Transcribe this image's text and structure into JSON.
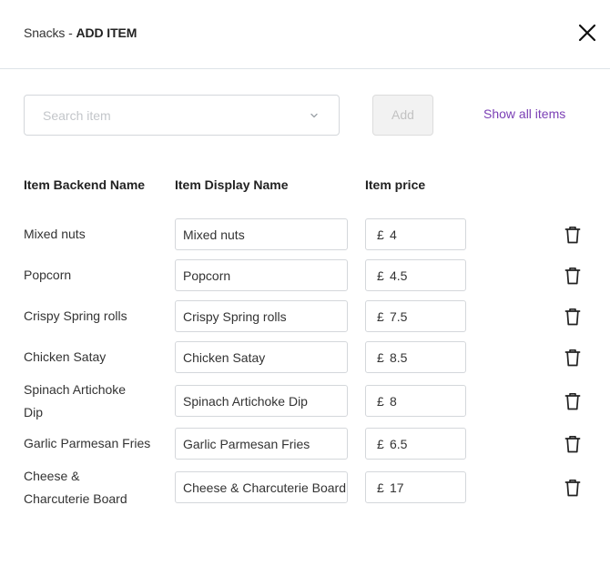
{
  "header": {
    "category": "Snacks",
    "separator": " - ",
    "action": "ADD ITEM"
  },
  "search": {
    "placeholder": "Search item",
    "value": ""
  },
  "add_label": "Add",
  "show_all_label": "Show all items",
  "columns": [
    "Item Backend Name",
    "Item Display Name",
    "Item price"
  ],
  "currency_symbol": "£",
  "items": [
    {
      "backend_lines": [
        "Mixed nuts"
      ],
      "display": "Mixed nuts",
      "price": "4"
    },
    {
      "backend_lines": [
        "Popcorn"
      ],
      "display": "Popcorn",
      "price": "4.5"
    },
    {
      "backend_lines": [
        "Crispy Spring rolls"
      ],
      "display": "Crispy Spring rolls",
      "price": "7.5"
    },
    {
      "backend_lines": [
        "Chicken Satay"
      ],
      "display": "Chicken Satay",
      "price": "8.5"
    },
    {
      "backend_lines": [
        "Spinach Artichoke",
        "Dip"
      ],
      "display": "Spinach Artichoke Dip",
      "price": "8"
    },
    {
      "backend_lines": [
        "Garlic Parmesan Fries"
      ],
      "display": "Garlic Parmesan Fries",
      "price": "6.5"
    },
    {
      "backend_lines": [
        "Cheese &",
        "Charcuterie Board"
      ],
      "display": "Cheese & Charcuterie Board",
      "price": "17"
    }
  ],
  "colors": {
    "link": "#7b3fb5",
    "border": "#d4d7db",
    "disabled_bg": "#f2f2f2",
    "disabled_text": "#c2c2c2"
  },
  "icons": {
    "close": "close-icon",
    "dropdown": "chevron-down-icon",
    "delete": "trash-icon"
  }
}
